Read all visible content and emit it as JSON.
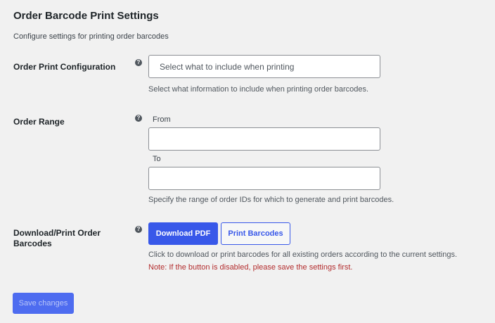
{
  "page": {
    "title": "Order Barcode Print Settings",
    "description": "Configure settings for printing order barcodes"
  },
  "print_config": {
    "label": "Order Print Configuration",
    "help_glyph": "?",
    "placeholder": "Select what to include when printing",
    "hint": "Select what information to include when printing order barcodes."
  },
  "order_range": {
    "label": "Order Range",
    "help_glyph": "?",
    "from_label": "From",
    "from_value": "",
    "to_label": "To",
    "to_value": "",
    "hint": "Specify the range of order IDs for which to generate and print barcodes."
  },
  "download_print": {
    "label": "Download/Print Order Barcodes",
    "help_glyph": "?",
    "download_button": "Download PDF",
    "print_button": "Print Barcodes",
    "hint": "Click to download or print barcodes for all existing orders according to the current settings.",
    "note": "Note: If the button is disabled, please save the settings first."
  },
  "footer": {
    "save_button": "Save changes"
  },
  "colors": {
    "primary": "#3858e9",
    "warning": "#b32d2e",
    "background": "#f1f1f1"
  }
}
